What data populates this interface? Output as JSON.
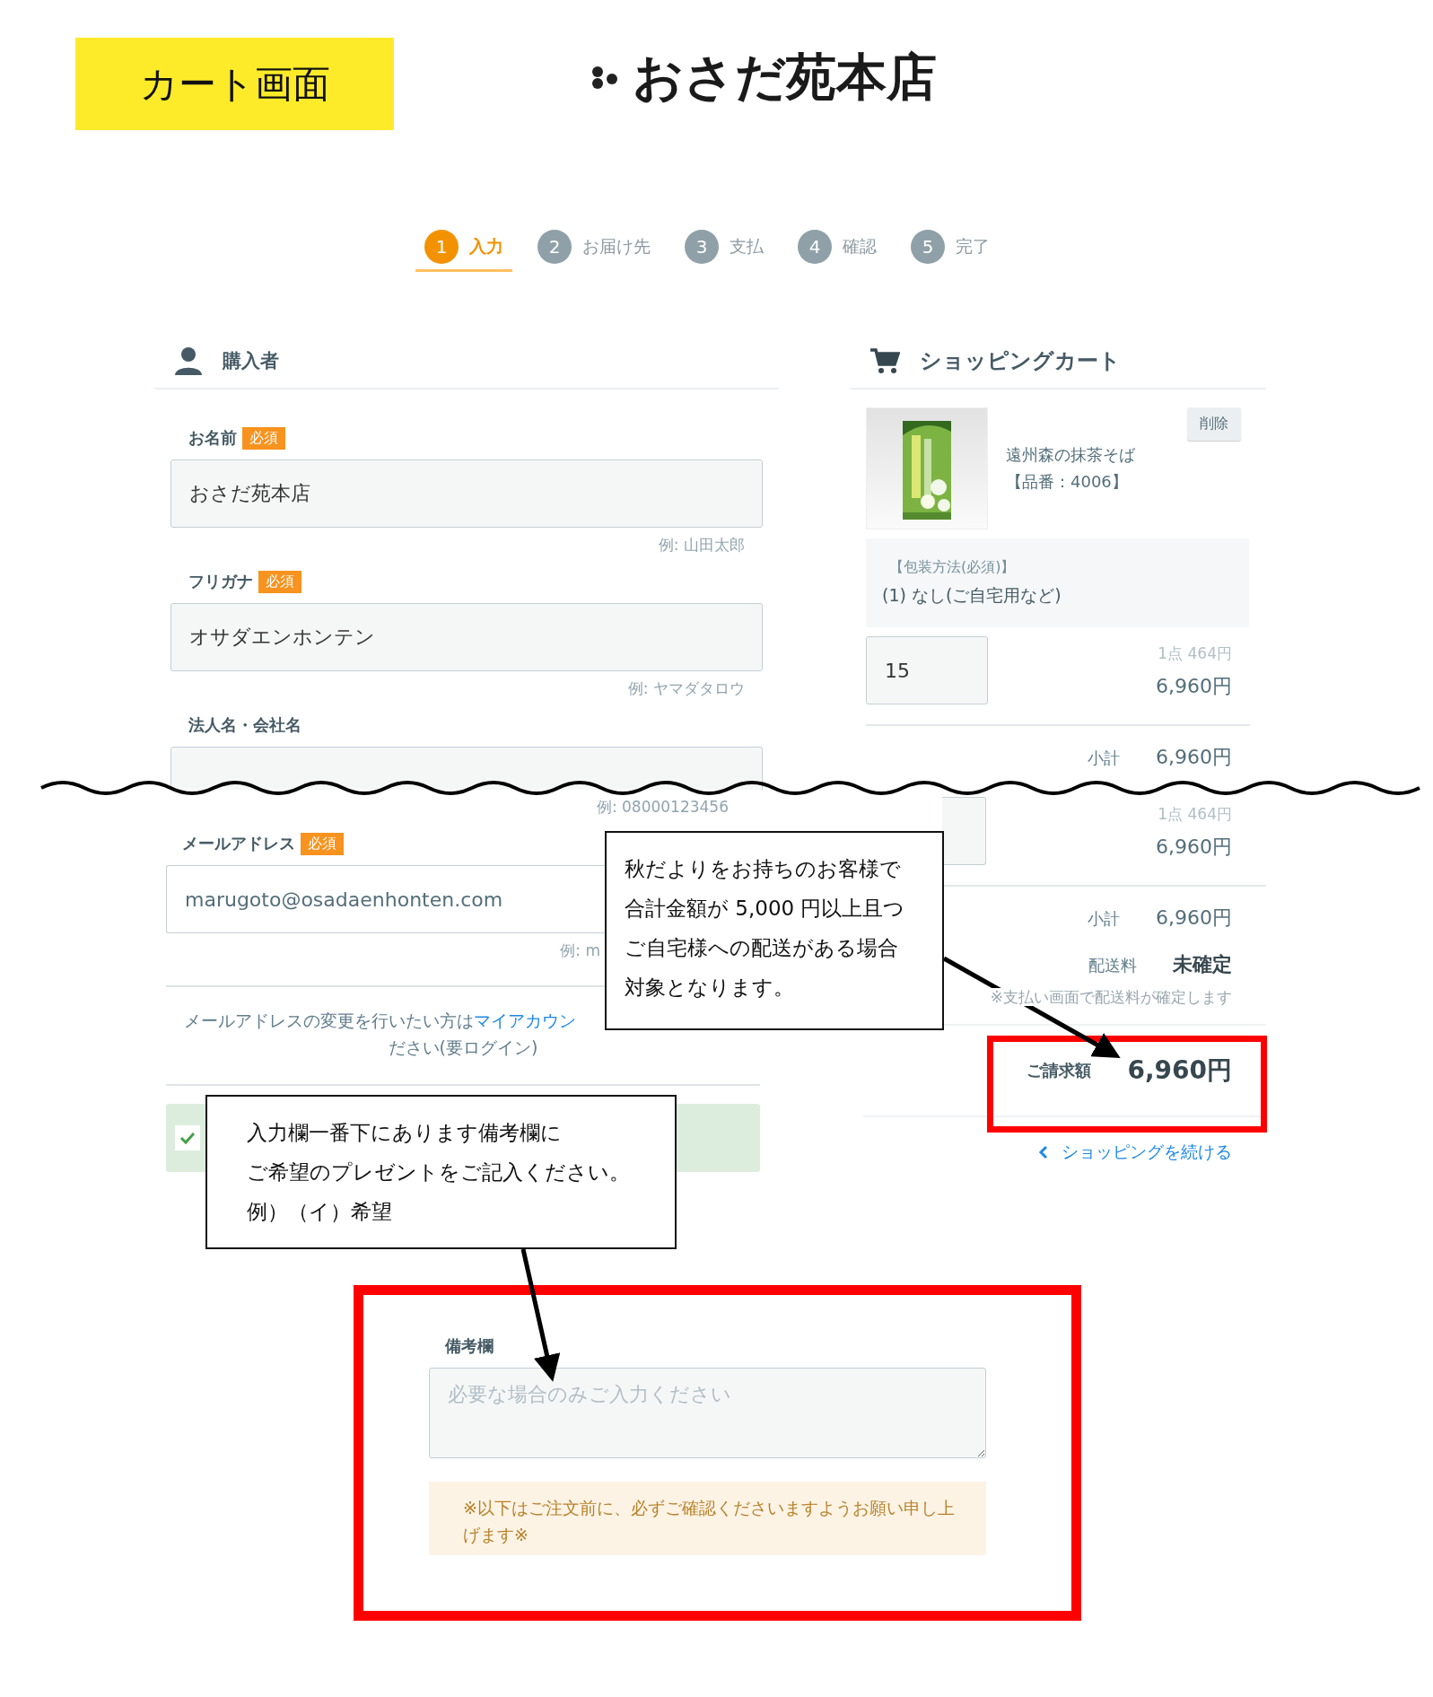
{
  "annotation_label": "カート画面",
  "logo": {
    "text": "おさだ苑本店"
  },
  "steps": [
    {
      "number": "1",
      "label": "入力",
      "selected": true
    },
    {
      "number": "2",
      "label": "お届け先",
      "selected": false
    },
    {
      "number": "3",
      "label": "支払",
      "selected": false
    },
    {
      "number": "4",
      "label": "確認",
      "selected": false
    },
    {
      "number": "5",
      "label": "完了",
      "selected": false
    }
  ],
  "buyer": {
    "title": "購入者",
    "fields": [
      {
        "label": "お名前",
        "badge": "必須",
        "value": "おさだ苑本店",
        "example": "例: 山田太郎"
      },
      {
        "label": "フリガナ",
        "badge": "必須",
        "value": "オサダエンホンテン",
        "example": "例: ヤマダタロウ"
      },
      {
        "label": "法人名・会社名"
      }
    ],
    "phone_example": "例: 08000123456",
    "email": {
      "label": "メールアドレス",
      "badge": "必須",
      "value": "marugoto@osadaenhonten.com",
      "example": "例: m"
    },
    "email_note": {
      "text": "メールアドレスの変更を行いたい方は",
      "link": "マイアカウン",
      "text_2": "ださい(要ログイン)"
    },
    "agreement": {
      "checked": true
    }
  },
  "cart": {
    "title": "ショッピングカート",
    "item": {
      "name": "遠州森の抹茶そば【品番：4006】",
      "delete": "削除",
      "option_label": "【包装方法(必須)】",
      "option_value": "(1) なし(ご自宅用など)",
      "quantity": "15",
      "unit_price": "1点 464円",
      "line_total": "6,960円"
    },
    "subtotal_label": "小計",
    "subtotal": "6,960円",
    "item_2": {
      "unit_price": "1点 464円",
      "line_total": "6,960円"
    },
    "subtotal_label_2": "小計",
    "subtotal_2": "6,960円",
    "shipping_label": "配送料",
    "shipping": "未確定",
    "shipping_note": "※支払い画面で配送料が確定します",
    "total_label": "ご請求額",
    "total": "6,960円",
    "continue_link": "ショッピングを続ける"
  },
  "remarks": {
    "label": "備考欄",
    "placeholder": "必要な場合のみご入力ください",
    "notice": "※以下はご注文前に、必ずご確認くださいますようお願い申し上げます※"
  },
  "callouts": [
    {
      "lines": [
        "秋だよりをお持ちのお客様で",
        "合計金額が 5,000 円以上且つ",
        "ご自宅様への配送がある場合",
        "対象となります。"
      ]
    },
    {
      "lines": [
        "入力欄一番下にあります備考欄に",
        "ご希望のプレゼントをご記入ください。",
        "例）（イ）希望"
      ]
    }
  ]
}
